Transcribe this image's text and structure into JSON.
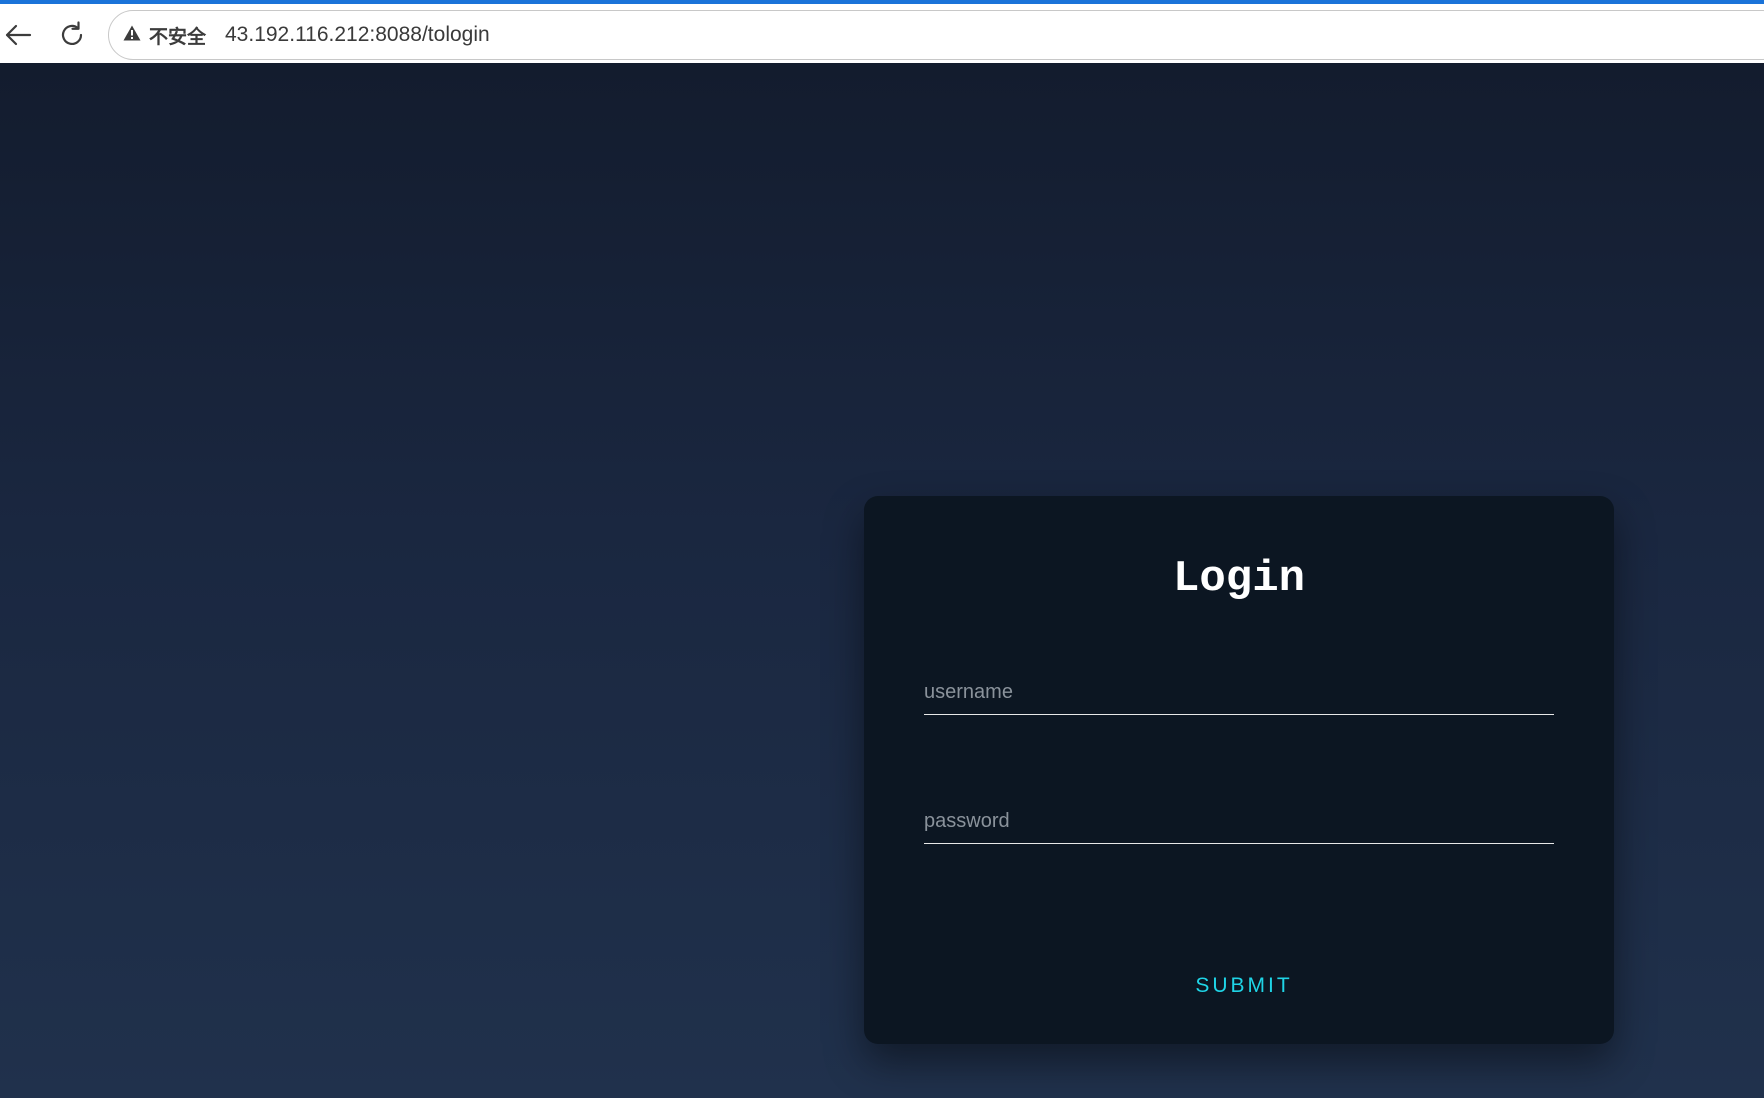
{
  "browser": {
    "security_label": "不安全",
    "url": "43.192.116.212:8088/tologin",
    "icons": {
      "back": "arrow-left-icon",
      "reload": "reload-icon",
      "warning": "warning-triangle-icon"
    },
    "accent_color": "#1a73d9"
  },
  "login": {
    "title": "Login",
    "username_placeholder": "username",
    "password_placeholder": "password",
    "submit_label": "SUBMIT",
    "submit_color": "#1fd4e6",
    "card_color": "#0c1622"
  }
}
